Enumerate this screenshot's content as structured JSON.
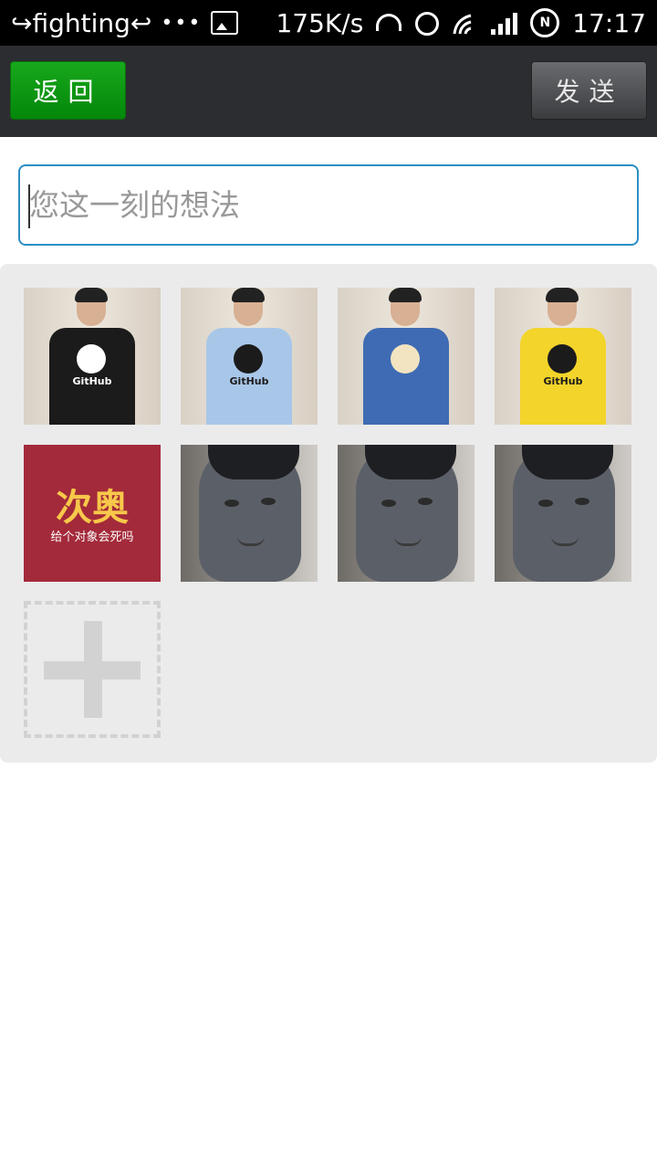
{
  "status_bar": {
    "carrier_text": "↪fighting↩",
    "dots": "•••",
    "net_speed": "175K/s",
    "time": "17:17",
    "icons": [
      "image-icon",
      "headset-icon",
      "alarm-icon",
      "wifi-icon",
      "signal-icon",
      "nfc-icon"
    ]
  },
  "toolbar": {
    "back_label": "返回",
    "send_label": "发送"
  },
  "compose": {
    "placeholder": "您这一刻的想法",
    "value": ""
  },
  "photos": [
    {
      "type": "person",
      "shirt_color": "#1b1b1b",
      "logo_color": "#ffffff",
      "text": "GitHub",
      "text_color": "#ffffff"
    },
    {
      "type": "person",
      "shirt_color": "#a8c7e8",
      "logo_color": "#1b1b1b",
      "text": "GitHub",
      "text_color": "#1b1b1b"
    },
    {
      "type": "person",
      "shirt_color": "#3e6bb3",
      "logo_color": "#f2e4c0",
      "text": "",
      "text_color": "#1b1b1b"
    },
    {
      "type": "person",
      "shirt_color": "#f2d42a",
      "logo_color": "#1b1b1b",
      "text": "GitHub",
      "text_color": "#1b1b1b"
    },
    {
      "type": "banner",
      "big_text": "次奥",
      "small_text": "给个对象会死吗"
    },
    {
      "type": "mask"
    },
    {
      "type": "mask"
    },
    {
      "type": "mask"
    }
  ],
  "add_photo": {
    "icon": "plus-icon"
  },
  "colors": {
    "accent_green": "#0a9a10",
    "input_border": "#2c8ec4",
    "panel_bg": "#ebebeb"
  }
}
